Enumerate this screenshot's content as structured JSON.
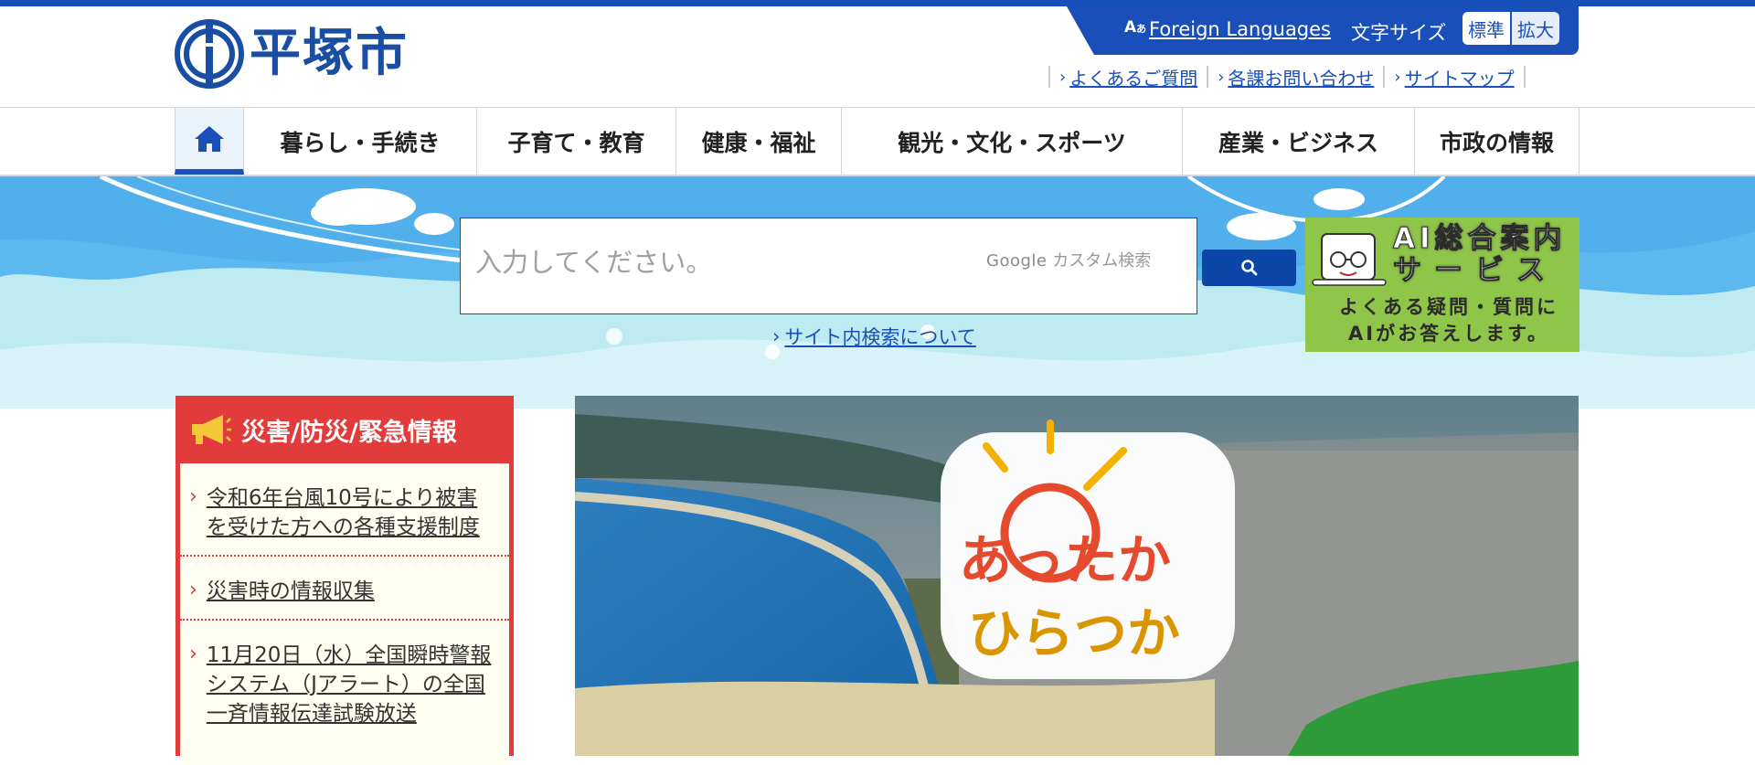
{
  "header": {
    "logo_text": "平塚市",
    "foreign_languages": "Foreign Languages",
    "font_size_label": "文字サイズ",
    "size_standard": "標準",
    "size_large": "拡大",
    "sub_links": [
      "よくあるご質問",
      "各課お問い合わせ",
      "サイトマップ"
    ]
  },
  "nav": {
    "items": [
      "暮らし・手続き",
      "子育て・教育",
      "健康・福祉",
      "観光・文化・スポーツ",
      "産業・ビジネス",
      "市政の情報"
    ]
  },
  "search": {
    "placeholder": "入力してください。",
    "google_label_brand": "Google",
    "google_label_text": "カスタム検索",
    "about_link": "サイト内検索について"
  },
  "ai_banner": {
    "title_line1": "AI総合案内",
    "title_line2": "サービス",
    "sub_line1": "よくある疑問・質問に",
    "sub_line2": "AIがお答えします。"
  },
  "emergency": {
    "title": "災害/防災/緊急情報",
    "items": [
      "令和6年台風10号により被害を受けた方への各種支援制度",
      "災害時の情報収集",
      "11月20日（水）全国瞬時警報システム（Jアラート）の全国一斉情報伝達試験放送"
    ]
  },
  "main_banner": {
    "logo_line1": "あったか",
    "logo_line2": "ひらつか"
  },
  "colors": {
    "brand_blue": "#1a4fb9",
    "emergency_red": "#e23b3b",
    "ai_green": "#8fc549"
  }
}
